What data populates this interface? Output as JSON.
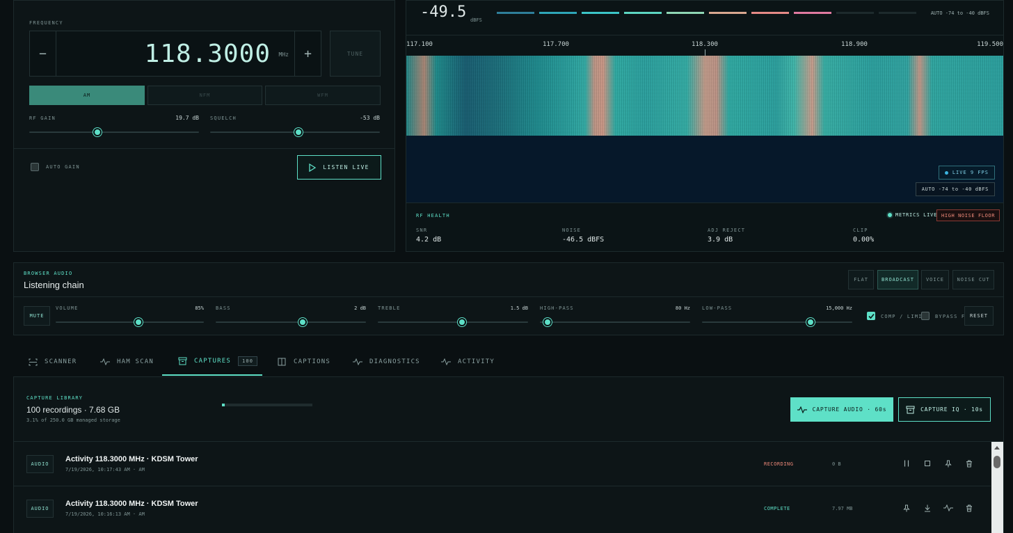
{
  "tuner": {
    "frequency_label": "FREQUENCY",
    "frequency_value": "118.3000",
    "frequency_unit": "MHz",
    "minus": "−",
    "plus": "+",
    "tune": "TUNE",
    "modes": [
      "AM",
      "NFM",
      "WFM"
    ],
    "active_mode": "AM",
    "rf_gain_label": "RF GAIN",
    "rf_gain_value": "19.7 dB",
    "rf_gain_fraction": 0.4,
    "squelch_label": "SQUELCH",
    "squelch_value": "-53 dB",
    "squelch_fraction": 0.52,
    "auto_gain": "AUTO GAIN",
    "listen_live": "LISTEN LIVE"
  },
  "spectrum": {
    "level_value": "-49.5",
    "level_unit": "dBFS",
    "auto_range": "AUTO -74 to -40 dBFS",
    "freq_ticks": [
      "117.100",
      "117.700",
      "118.300",
      "118.900",
      "119.500"
    ],
    "live_badge": "LIVE 9 FPS",
    "range_badge": "AUTO -74 to -40 dBFS",
    "meter_colors": [
      "#2f7f9a",
      "#2fa6b8",
      "#3cc6c8",
      "#5dd6c2",
      "#8fd6b4",
      "#d9a890",
      "#e58a86",
      "#e07aa0",
      "#1d2a2c",
      "#1d2a2c"
    ]
  },
  "rf_health": {
    "title": "RF HEALTH",
    "metrics_live": "METRICS LIVE",
    "alert": "HIGH NOISE FLOOR",
    "metrics": [
      {
        "label": "SNR",
        "value": "4.2 dB"
      },
      {
        "label": "NOISE",
        "value": "-46.5 dBFS"
      },
      {
        "label": "ADJ REJECT",
        "value": "3.9 dB"
      },
      {
        "label": "CLIP",
        "value": "0.00%"
      }
    ]
  },
  "audio": {
    "section_label": "BROWSER AUDIO",
    "title": "Listening chain",
    "presets": [
      "FLAT",
      "BROADCAST",
      "VOICE",
      "NOISE CUT"
    ],
    "active_preset": "BROADCAST",
    "mute": "MUTE",
    "sliders": [
      {
        "label": "VOLUME",
        "value": "85%",
        "fraction": 0.56
      },
      {
        "label": "BASS",
        "value": "2 dB",
        "fraction": 0.58
      },
      {
        "label": "TREBLE",
        "value": "1.5 dB",
        "fraction": 0.56
      },
      {
        "label": "HIGH-PASS",
        "value": "80 Hz",
        "fraction": 0.05
      },
      {
        "label": "LOW-PASS",
        "value": "15,000 Hz",
        "fraction": 0.72
      }
    ],
    "comp_limit": "COMP / LIMIT",
    "bypass_fx": "BYPASS FX",
    "reset": "RESET"
  },
  "tabs": [
    {
      "label": "SCANNER",
      "icon": "scanner-icon"
    },
    {
      "label": "HAM SCAN",
      "icon": "pulse-icon"
    },
    {
      "label": "CAPTURES",
      "icon": "archive-icon",
      "badge": "100"
    },
    {
      "label": "CAPTIONS",
      "icon": "book-icon"
    },
    {
      "label": "DIAGNOSTICS",
      "icon": "pulse-icon"
    },
    {
      "label": "ACTIVITY",
      "icon": "pulse-icon"
    }
  ],
  "library": {
    "section_label": "CAPTURE LIBRARY",
    "summary": "100 recordings · 7.68 GB",
    "storage": "3.1% of 250.0 GB managed storage",
    "storage_fraction": 0.031,
    "capture_audio": "CAPTURE AUDIO · 60s",
    "capture_iq": "CAPTURE IQ · 10s",
    "rows": [
      {
        "type": "AUDIO",
        "title": "Activity 118.3000 MHz · KDSM Tower",
        "time": "7/19/2026, 10:17:43 AM · AM",
        "status": "RECORDING",
        "size": "0 B"
      },
      {
        "type": "AUDIO",
        "title": "Activity 118.3000 MHz · KDSM Tower",
        "time": "7/19/2026, 10:16:13 AM · AM",
        "status": "COMPLETE",
        "size": "7.97 MB"
      }
    ]
  }
}
